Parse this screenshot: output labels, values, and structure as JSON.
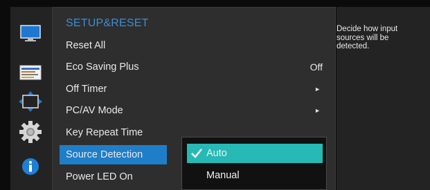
{
  "menu": {
    "title": "SETUP&RESET",
    "items": [
      {
        "label": "Reset All",
        "value": "",
        "arrow": ""
      },
      {
        "label": "Eco Saving Plus",
        "value": "Off",
        "arrow": ""
      },
      {
        "label": "Off Timer",
        "value": "",
        "arrow": "►"
      },
      {
        "label": "PC/AV Mode",
        "value": "",
        "arrow": "►"
      },
      {
        "label": "Key Repeat Time",
        "value": "",
        "arrow": ""
      },
      {
        "label": "Source Detection",
        "value": "",
        "arrow": ""
      },
      {
        "label": "Power LED On",
        "value": "",
        "arrow": ""
      }
    ],
    "selected_index": 5
  },
  "submenu": {
    "items": [
      {
        "label": "Auto",
        "checked": true
      },
      {
        "label": "Manual",
        "checked": false
      }
    ]
  },
  "help": {
    "text": "Decide how input sources will be detected."
  },
  "rail": {
    "icons": [
      "picture-icon",
      "onscreen-display-icon",
      "position-arrows-icon",
      "gear-icon",
      "info-icon"
    ],
    "colors": {
      "accent_blue": "#1f7ec8",
      "highlight_teal": "#26b9b5",
      "title_blue": "#3b8fd4"
    }
  }
}
